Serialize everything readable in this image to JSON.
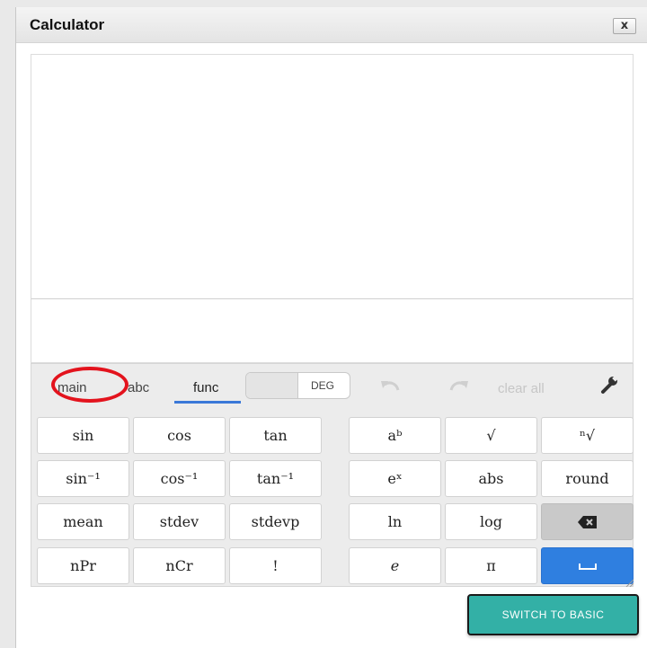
{
  "window": {
    "title": "Calculator",
    "close_label": "x"
  },
  "tabs": [
    {
      "label": "main",
      "annotated": true
    },
    {
      "label": "abc"
    },
    {
      "label": "func",
      "active": true
    }
  ],
  "toolbar": {
    "angle_mode": "DEG",
    "clear_all": "clear all",
    "undo_icon": "undo-icon",
    "redo_icon": "redo-icon",
    "settings_icon": "wrench-icon"
  },
  "keypad": {
    "left": [
      [
        "sin",
        "cos",
        "tan"
      ],
      [
        "sin⁻¹",
        "cos⁻¹",
        "tan⁻¹"
      ],
      [
        "mean",
        "stdev",
        "stdevp"
      ],
      [
        "nPr",
        "nCr",
        "!"
      ]
    ],
    "right": [
      [
        "aᵇ",
        "√",
        "ⁿ√"
      ],
      [
        "eˣ",
        "abs",
        "round"
      ],
      [
        "ln",
        "log",
        "backspace-icon"
      ],
      [
        "e",
        "π",
        "enter-icon"
      ]
    ]
  },
  "footer": {
    "switch_label": "SWITCH TO BASIC"
  },
  "colors": {
    "accent": "#3a78d8",
    "enter": "#2f7fe0",
    "switch": "#33b0a6",
    "annotation": "#e3131d"
  }
}
